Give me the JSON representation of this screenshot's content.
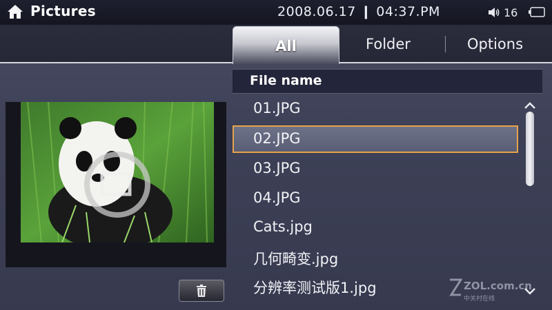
{
  "status_bar": {
    "title": "Pictures",
    "datetime": "2008.06.17 ❙ 04:37.PM",
    "volume_level": "16",
    "icons": {
      "home": "home-icon",
      "volume": "speaker-icon",
      "battery": "battery-icon"
    }
  },
  "tabs": [
    {
      "label": "All",
      "active": true
    },
    {
      "label": "Folder",
      "active": false
    },
    {
      "label": "Options",
      "active": false
    }
  ],
  "list": {
    "header": "File name",
    "files": [
      "01.JPG",
      "02.JPG",
      "03.JPG",
      "04.JPG",
      "Cats.jpg",
      "几何畸变.jpg",
      "分辨率测试版1.jpg"
    ],
    "selected_index": 1
  },
  "preview": {
    "delete_icon": "trash-icon"
  },
  "watermark": {
    "text": "ZOL.com.cn",
    "sub": "中关村在线"
  },
  "colors": {
    "selection_border": "#e8a34a",
    "status_bar": "#1a1b28",
    "background": "#3e4157"
  }
}
